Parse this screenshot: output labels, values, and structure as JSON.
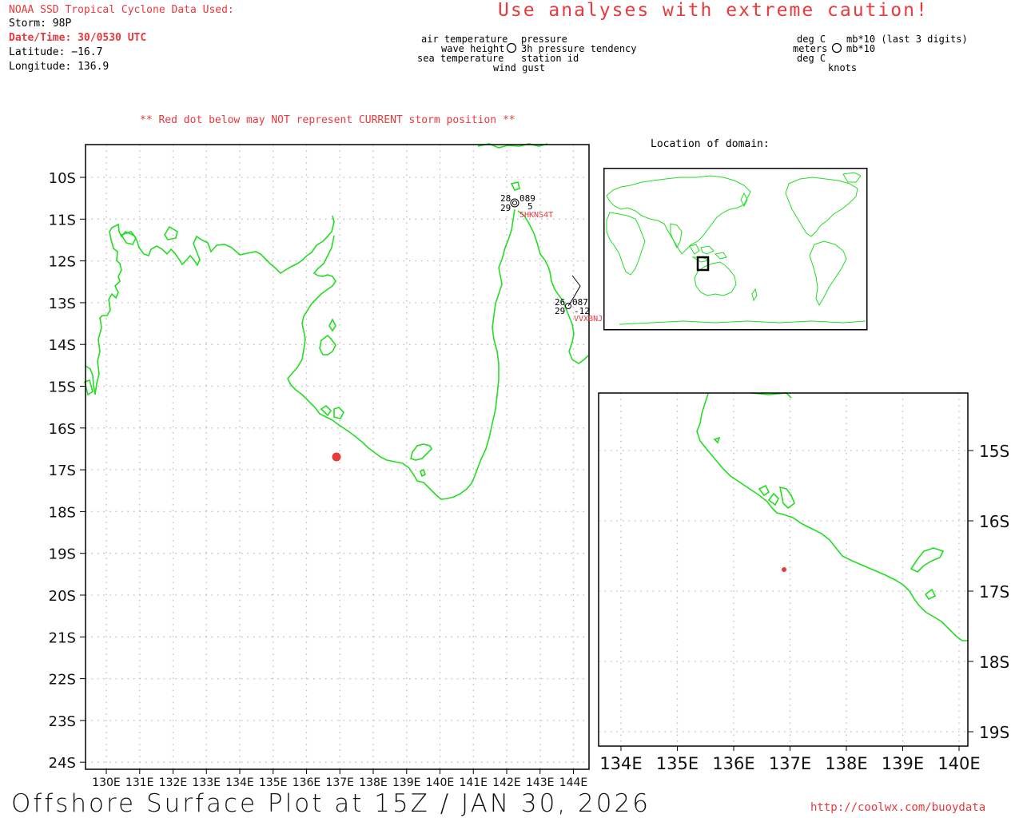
{
  "header": {
    "source": "NOAA SSD Tropical Cyclone Data Used:",
    "storm": "Storm: 98P",
    "datetime": "Date/Time: 30/0530 UTC",
    "latitude": "Latitude: −16.7",
    "longitude": "Longitude: 136.9",
    "caution": "Use analyses with extreme caution!"
  },
  "legend_left": {
    "tl": "air temperature",
    "ml": "wave height",
    "bl": "sea temperature",
    "tr": "pressure",
    "mr": "3h pressure tendency",
    "br": "station id",
    "bottom": "wind gust"
  },
  "legend_right": {
    "tl": "deg C",
    "ml": "meters",
    "bl": "deg C",
    "tr": "mb*10 (last 3 digits)",
    "mr": "mb*10",
    "bottom": "knots"
  },
  "warning": "** Red dot below may NOT represent CURRENT storm position **",
  "location_label": "Location of domain:",
  "main_map": {
    "lat_labels": [
      "10S",
      "11S",
      "12S",
      "13S",
      "14S",
      "15S",
      "16S",
      "17S",
      "18S",
      "19S",
      "20S",
      "21S",
      "22S",
      "23S",
      "24S"
    ],
    "lon_labels": [
      "130E",
      "131E",
      "132E",
      "133E",
      "134E",
      "135E",
      "136E",
      "137E",
      "138E",
      "139E",
      "140E",
      "141E",
      "142E",
      "143E",
      "144E"
    ],
    "storm": {
      "lat": -16.7,
      "lon": 136.9
    }
  },
  "stations": [
    {
      "air_temp": "28",
      "pressure": "089",
      "sea_temp": "29",
      "tendency": "5",
      "id": "5HKNS4T"
    },
    {
      "air_temp": "26",
      "pressure": "087",
      "sea_temp": "29",
      "tendency": "-12",
      "id": "VVXBNJJ"
    }
  ],
  "inset_map": {
    "lat_labels": [
      "15S",
      "16S",
      "17S",
      "18S",
      "19S"
    ],
    "lon_labels": [
      "134E",
      "135E",
      "136E",
      "137E",
      "138E",
      "139E",
      "140E"
    ]
  },
  "footer": {
    "title": "Offshore Surface Plot at 15Z / JAN 30, 2026",
    "url": "http://coolwx.com/buoydata"
  },
  "colors": {
    "coast": "#22dd22",
    "storm": "#e8393c",
    "grid": "#bbbbbb"
  }
}
